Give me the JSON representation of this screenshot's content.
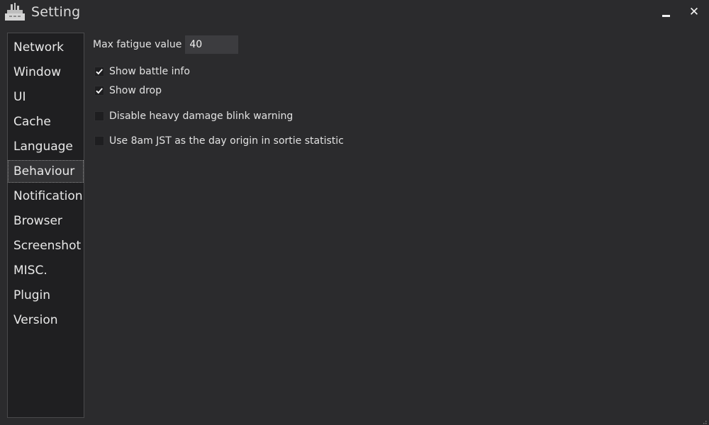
{
  "window": {
    "title": "Setting",
    "app_icon": "ship-icon",
    "minimize_icon": "minimize-icon",
    "close_icon": "close-icon",
    "close_glyph": "✕"
  },
  "sidebar": {
    "items": [
      {
        "label": "Network",
        "selected": false
      },
      {
        "label": "Window",
        "selected": false
      },
      {
        "label": "UI",
        "selected": false
      },
      {
        "label": "Cache",
        "selected": false
      },
      {
        "label": "Language",
        "selected": false
      },
      {
        "label": "Behaviour",
        "selected": true
      },
      {
        "label": "Notification",
        "selected": false
      },
      {
        "label": "Browser",
        "selected": false
      },
      {
        "label": "Screenshot",
        "selected": false
      },
      {
        "label": "MISC.",
        "selected": false
      },
      {
        "label": "Plugin",
        "selected": false
      },
      {
        "label": "Version",
        "selected": false
      }
    ]
  },
  "behaviour": {
    "max_fatigue": {
      "label": "Max fatigue value",
      "value": "40"
    },
    "options": [
      {
        "label": "Show battle info",
        "checked": true
      },
      {
        "label": "Show drop",
        "checked": true
      },
      {
        "label": "Disable heavy damage blink warning",
        "checked": false
      },
      {
        "label": "Use 8am JST as the day origin in sortie statistic",
        "checked": false
      }
    ]
  },
  "colors": {
    "background": "#2b2b2d",
    "sidebar_background": "#1f1f21",
    "text": "#e6e6e6",
    "selected_item": "#333335",
    "input_background": "#3c3c3f"
  }
}
